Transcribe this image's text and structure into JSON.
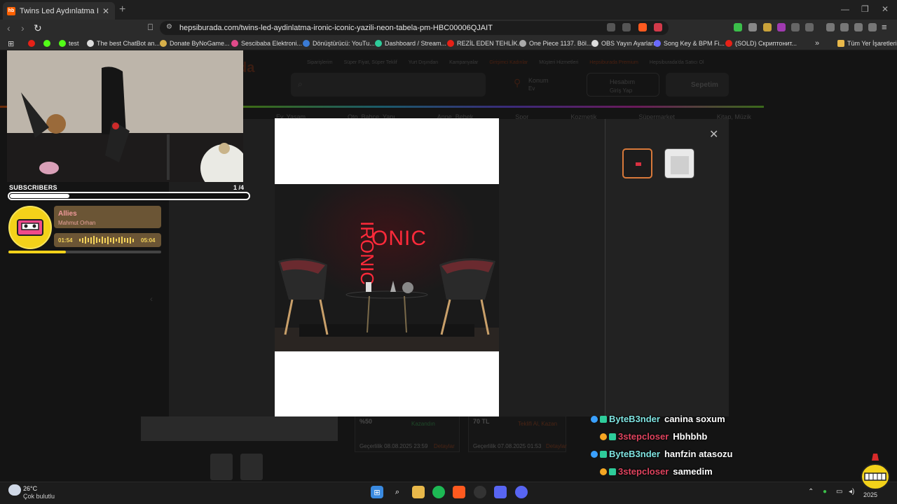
{
  "browser": {
    "tab_title": "Twins Led Aydınlatma Ironic Icon",
    "favicon_text": "hb",
    "url": "hepsiburada.com/twins-led-aydinlatma-ironic-iconic-yazili-neon-tabela-pm-HBC00006QJAIT",
    "bookmarks": [
      {
        "label": "",
        "color": "#e62117"
      },
      {
        "label": "",
        "color": "#53fc18"
      },
      {
        "label": "test",
        "color": "#53fc18"
      },
      {
        "label": "The best ChatBot an...",
        "color": "#dddddd"
      },
      {
        "label": "Donate ByNoGame...",
        "color": "#d8b04a"
      },
      {
        "label": "Sescibaba Elektroni...",
        "color": "#e04a8a"
      },
      {
        "label": "Dönüştürücü: YouTu...",
        "color": "#3a7bd5"
      },
      {
        "label": "Dashboard / Stream...",
        "color": "#2ecc9a"
      },
      {
        "label": "REZİL EDEN TEHLİK...",
        "color": "#e62117"
      },
      {
        "label": "One Piece 1137. Böl...",
        "color": "#aaaaaa"
      },
      {
        "label": "OBS Yayın Ayarları",
        "color": "#dddddd"
      },
      {
        "label": "Song Key & BPM Fi...",
        "color": "#6a6aff"
      },
      {
        "label": "(SOLD) Скриптонит...",
        "color": "#e62117"
      }
    ],
    "all_bookmarks": "Tüm Yer İşaretleri"
  },
  "stream": {
    "subscribers_label": "SUBSCRIBERS",
    "subscribers_current": "1",
    "subscribers_sep": "/",
    "subscribers_goal": "4",
    "subscribers_progress": 0.25,
    "music": {
      "song": "Allies",
      "artist": "Mahmut Orhan",
      "time_now": "01:54",
      "time_end": "05:04",
      "progress": 0.375
    }
  },
  "site": {
    "header_links": [
      "Siparişlerim",
      "Süper Fiyat, Süper Teklif",
      "Yurt Dışından",
      "Kampanyalar",
      "Girişimci Kadınlar",
      "Müşteri Hizmetleri",
      "Hepsiburada Premium",
      "Hepsiburada'da Satıcı Ol"
    ],
    "location_label": "Konum",
    "location_sub": "Ev",
    "account_label": "Hesabım",
    "account_sub": "Giriş Yap",
    "cart_label": "Sepetim",
    "cart_count": "0",
    "categories": [
      "Ev, Yaşam",
      "Oto, Bahçe, Yapı",
      "Anne, Bebek",
      "Spor",
      "Kozmetik",
      "Süpermarket",
      "Kitap, Müzik"
    ],
    "offers": [
      {
        "price": "%50",
        "status": "Kazandın",
        "footer_left": "Geçerlilik 08.08.2025 23:59",
        "footer_right": "Detaylar"
      },
      {
        "price": "70 TL",
        "status": "Teklifi Al, Kazan",
        "footer_left": "Geçerlilik 07.08.2025 01:53",
        "footer_right": "Detaylar"
      }
    ]
  },
  "modal": {
    "close_icon": "close-icon",
    "product_sign_text": "IRONIC",
    "thumbnails": [
      "thumb-neon-sign",
      "thumb-packaging"
    ]
  },
  "chat": [
    {
      "user": "ByteB3nder",
      "message": "canina soxum",
      "user_color": "#7fe3e0"
    },
    {
      "user": "3stepcloser",
      "message": "Hbhbhb",
      "user_color": "#e0445f"
    },
    {
      "user": "ByteB3nder",
      "message": "hanfzin atasozu",
      "user_color": "#7fe3e0"
    },
    {
      "user": "3stepcloser",
      "message": "samedim",
      "user_color": "#e0445f"
    }
  ],
  "taskbar": {
    "weather_temp": "26°C",
    "weather_desc": "Çok bulutlu",
    "clock_date": "2025"
  }
}
